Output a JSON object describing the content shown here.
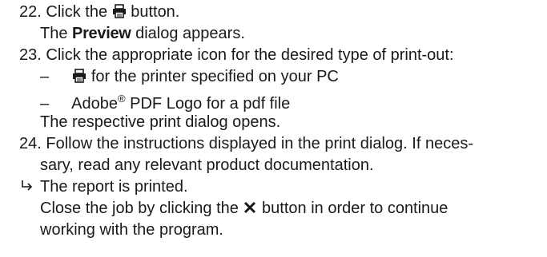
{
  "steps": [
    {
      "number": "22.",
      "text_before": "Click the",
      "text_after": "button.",
      "result_prefix": "The",
      "result_bold": "Preview",
      "result_suffix": "dialog appears."
    },
    {
      "number": "23.",
      "text": "Click the appropriate icon for the desired type of print-out:",
      "bullets": [
        {
          "dash": "–",
          "text": "for the printer specified on your PC"
        },
        {
          "dash": "–",
          "text_before": "Adobe",
          "superscript": "®",
          "text_after": "PDF Logo for a pdf file"
        }
      ],
      "result": "The respective print dialog opens."
    },
    {
      "number": "24.",
      "text_line1": "Follow the instructions displayed in the print dialog. If neces-",
      "text_line2": "sary, read any relevant product documentation."
    }
  ],
  "result": {
    "line1": "The report is printed.",
    "line2_before": "Close the job by clicking the",
    "line2_after": "button in order to continue",
    "line3": "working with the program."
  },
  "icons": {
    "print": "printer-icon",
    "close": "close-x-icon",
    "result_arrow": "result-arrow-icon"
  }
}
